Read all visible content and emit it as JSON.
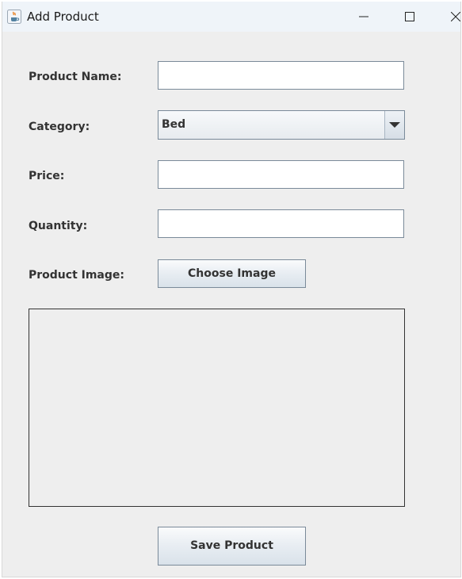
{
  "window": {
    "title": "Add Product",
    "icon": "java-coffee-cup-icon"
  },
  "titlebar_buttons": {
    "minimize_icon": "minimize-icon",
    "maximize_icon": "maximize-icon",
    "close_icon": "close-icon"
  },
  "form": {
    "product_name": {
      "label": "Product Name:",
      "value": ""
    },
    "category": {
      "label": "Category:",
      "value": "Bed"
    },
    "price": {
      "label": "Price:",
      "value": ""
    },
    "quantity": {
      "label": "Quantity:",
      "value": ""
    },
    "product_image": {
      "label": "Product Image:",
      "button_label": "Choose Image"
    }
  },
  "save_button_label": "Save Product",
  "colors": {
    "window_bg": "#eeeeee",
    "titlebar_bg": "#eff4f9",
    "border": "#7a8a99"
  }
}
